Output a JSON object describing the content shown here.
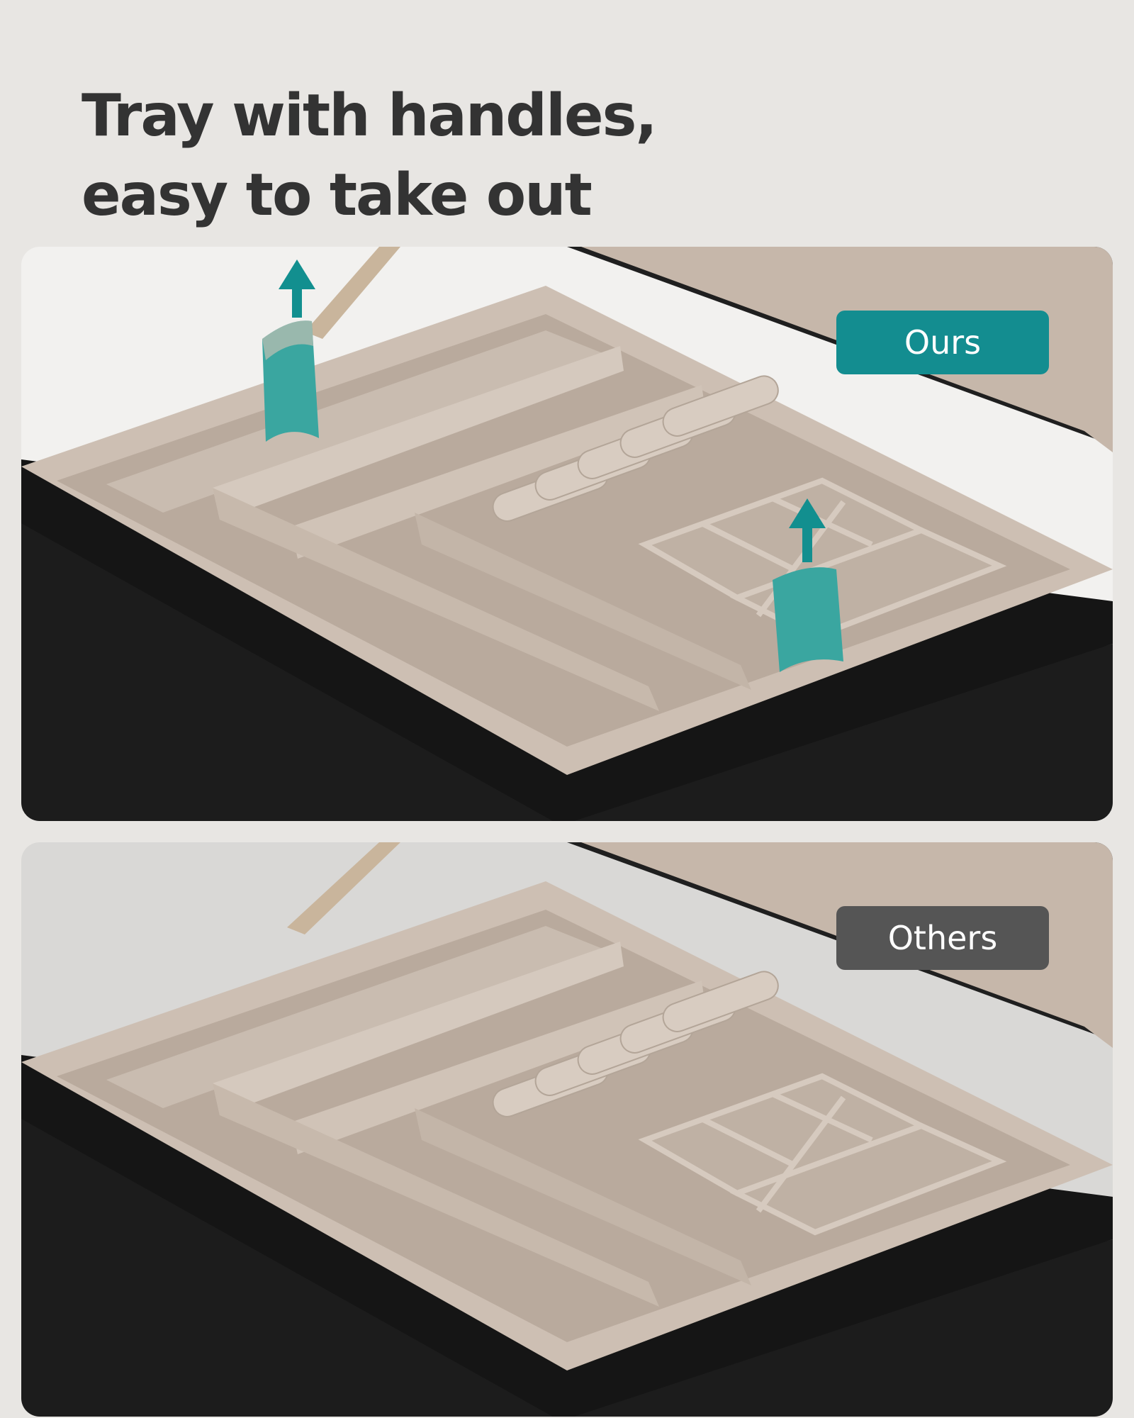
{
  "headline": {
    "line1": "Tray with handles,",
    "line2": "easy to take out"
  },
  "panels": [
    {
      "label": "Ours",
      "label_color": "#138d90",
      "handles": true,
      "handle_color": "#3aa6a0",
      "arrow_color": "#128f8f"
    },
    {
      "label": "Others",
      "label_color": "#555555",
      "handles": false
    }
  ],
  "colors": {
    "page_background": "#e8e6e3",
    "box_leather": "#1c1c1c",
    "velvet_lining": "#c3b5a9",
    "velvet_shadow": "#a89a8e"
  },
  "icons": [
    "arrow-up-icon"
  ]
}
